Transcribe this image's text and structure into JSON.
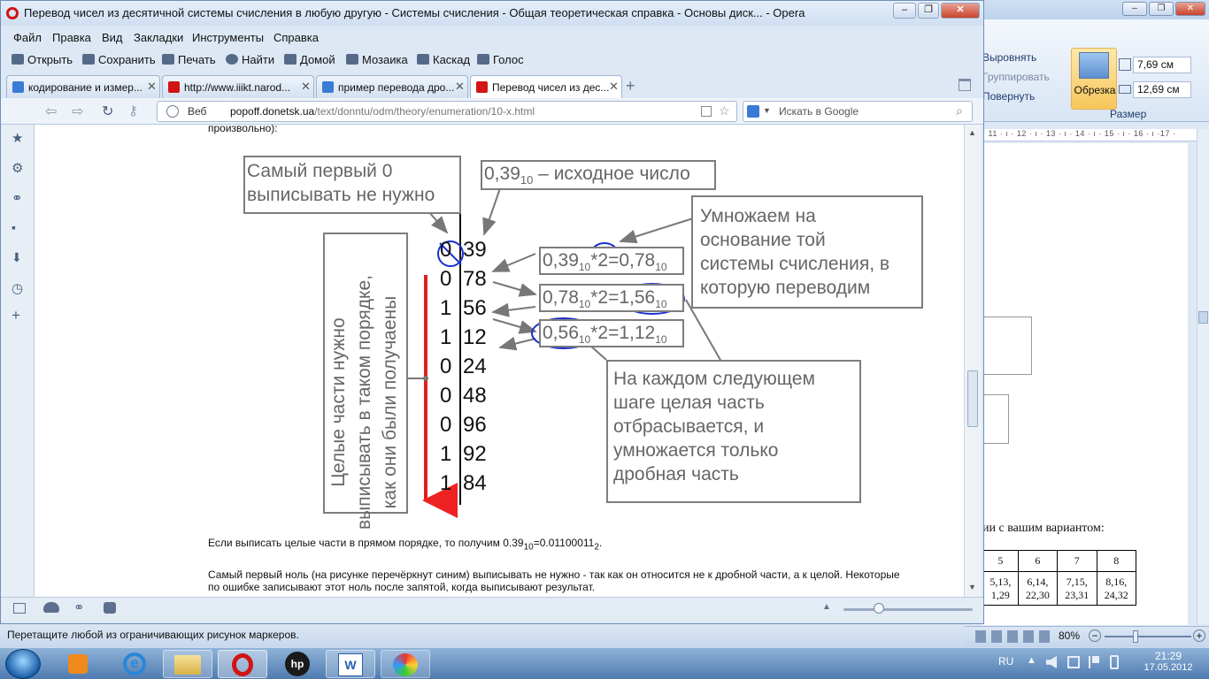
{
  "opera": {
    "title": "Перевод чисел из десятичной системы счисления в любую другую - Системы счисления - Общая теоретическая справка - Основы диск... - Opera",
    "menu": [
      "Файл",
      "Правка",
      "Вид",
      "Закладки",
      "Инструменты",
      "Справка"
    ],
    "toolbar": [
      "Открыть",
      "Сохранить",
      "Печать",
      "Найти",
      "Домой",
      "Мозаика",
      "Каскад",
      "Голос"
    ],
    "tabs": [
      {
        "label": "кодирование и измер...",
        "fav_color": "#3a7bd5"
      },
      {
        "label": "http://www.iiikt.narod...",
        "fav_color": "#d21414"
      },
      {
        "label": "пример перевода дро...",
        "fav_color": "#3a7bd5"
      },
      {
        "label": "Перевод чисел из дес...",
        "fav_color": "#d21414"
      }
    ],
    "address": {
      "prefix": "Веб",
      "host": "popoff.donetsk.ua",
      "path": "/text/donntu/odm/theory/enumeration/10-x.html"
    },
    "search_placeholder": "Искать в Google"
  },
  "page": {
    "top_fragment": "произвольно):",
    "fig": {
      "box_first_zero": [
        "Самый первый 0",
        "выписывать не нужно"
      ],
      "box_source": {
        "main": "0,39",
        "sub": "10",
        "rest": " – исходное число"
      },
      "box_multiply": [
        "Умножаем на",
        "основание той",
        "системы счисления, в",
        "которую переводим"
      ],
      "box_each_step": [
        "На каждом следующем",
        "шаге целая часть",
        "отбрасывается, и",
        "умножается только",
        "дробная часть"
      ],
      "vertical_note": [
        "Целые части нужно",
        "выписывать в таком порядке,",
        "как они были получаены"
      ],
      "int_digits": [
        "0",
        "0",
        "1",
        "1",
        "0",
        "0",
        "0",
        "1",
        "1"
      ],
      "frac_digits": [
        "39",
        "78",
        "56",
        "12",
        "24",
        "48",
        "96",
        "92",
        "84"
      ],
      "eq1": {
        "a": "0,39",
        "as": "10",
        "b": "*2=0,78",
        "bs": "10"
      },
      "eq2": {
        "a": "0,78",
        "as": "10",
        "b": "*2=1,56",
        "bs": "10"
      },
      "eq3": {
        "a": "0,56",
        "as": "10",
        "b": "*2=1,12",
        "bs": "10"
      }
    },
    "para1": {
      "text": "Если выписать целые части в прямом порядке, то получим 0.39",
      "sub1": "10",
      "text2": "=0.01100011",
      "sub2": "2",
      "end": "."
    },
    "para2_line1": "Самый первый ноль (на рисунке перечёркнут синим) выписывать не нужно - так как он относится не к дробной части, а к целой. Некоторые",
    "para2_line2": "по ошибке записывают этот ноль после запятой, когда выписывают результат."
  },
  "word": {
    "ribbon_items": [
      "Выровнять",
      "Группировать",
      "Повернуть"
    ],
    "crop_label": "Обрезка",
    "height": "7,69 см",
    "width": "12,69 см",
    "group_label": "Размер",
    "ruler": "· 11 · ı · 12 · ı · 13 · ı · 14 · ı · 15 · ı · 16 · ı ·17 ·",
    "doc_text": "ии с вашим вариантом:",
    "table_head": [
      "5",
      "6",
      "7",
      "8"
    ],
    "table_row": [
      "5,13, 1,29",
      "6,14, 22,30",
      "7,15, 23,31",
      "8,16, 24,32"
    ],
    "zoom": "80%"
  },
  "status_text": "Перетащите любой из ограничивающих рисунок маркеров.",
  "tray": {
    "lang": "RU",
    "time": "21:29",
    "date": "17.05.2012"
  }
}
